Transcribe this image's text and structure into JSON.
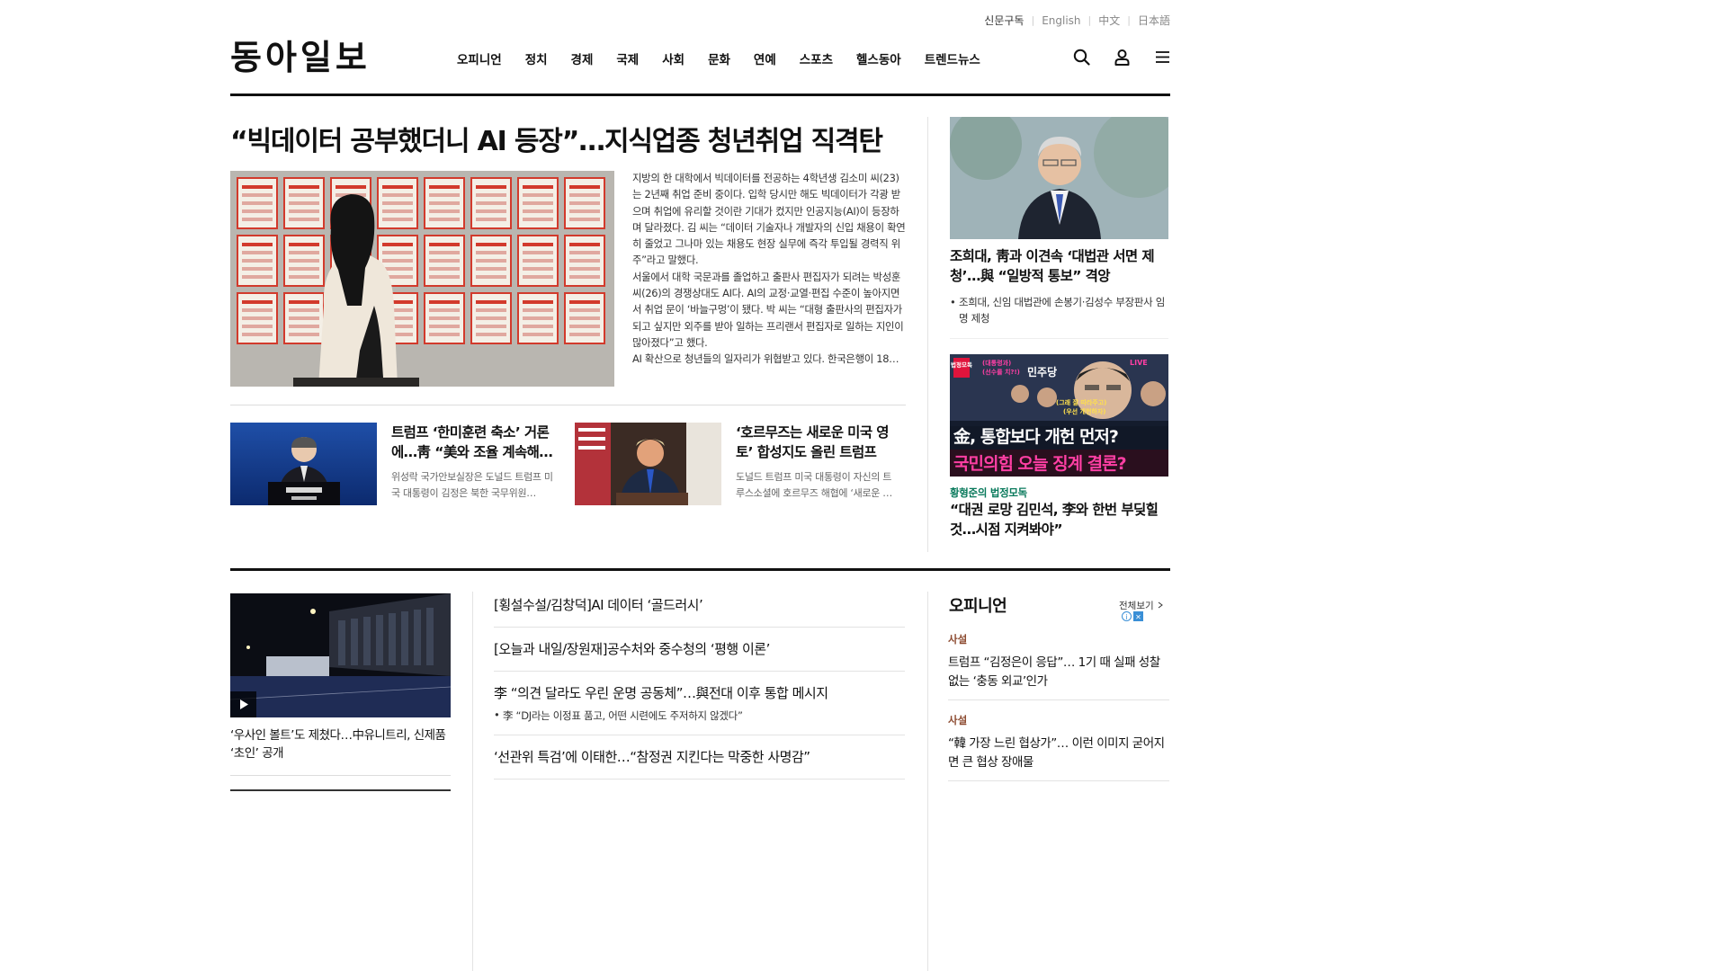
{
  "util_links": {
    "subscribe": "신문구독",
    "english": "English",
    "chinese": "中文",
    "japanese": "日本語"
  },
  "logo": "동아일보",
  "gnb": [
    "오피니언",
    "정치",
    "경제",
    "국제",
    "사회",
    "문화",
    "연예",
    "스포츠",
    "헬스동아",
    "트렌드뉴스"
  ],
  "icons": {
    "search": "search-icon",
    "user": "user-icon",
    "menu": "menu-icon",
    "play": "play-icon"
  },
  "top_story": {
    "title": "“빅데이터 공부했더니 AI 등장”…지식업종 청년취업 직격탄",
    "paragraphs": [
      "지방의 한 대학에서 빅데이터를 전공하는 4학년생 김소미 씨(23)는 2년째 취업 준비 중이다. 입학 당시만 해도 빅데이터가 각광 받으며 취업에 유리할 것이란 기대가 컸지만 인공지능(AI)이 등장하며 달라졌다. 김 씨는 “데이터 기술자나 개발자의 신입 채용이 확연히 줄었고 그나마 있는 채용도 현장 실무에 즉각 투입될 경력직 위주”라고 말했다.",
      "서울에서 대학 국문과를 졸업하고 출판사 편집자가 되려는 박성훈 씨(26)의 경쟁상대도 AI다. AI의 교정·교열·편집 수준이 높아지면서 취업 문이 ‘바늘구멍’이 됐다. 박 씨는 “대형 출판사의 편집자가 되고 싶지만 외주를 받아 일하는 프리랜서 편집자로 일하는 지인이 많아졌다”고 했다.",
      "AI 확산으로 청년들의 일자리가 위협받고 있다. 한국은행이 18…"
    ]
  },
  "sub_stories": [
    {
      "title": "트럼프 ‘한미훈련 축소’ 거론에…靑 “美와 조율 계속해 …",
      "desc": "위성락 국가안보실장은 도널드 트럼프 미국 대통령이 김정은 북한 국무위원…"
    },
    {
      "title": "‘호르무즈는 새로운 미국 영토’ 합성지도 올린 트럼프",
      "desc": "도널드 트럼프 미국 대통령이 자신의 트루스소셜에 호르무즈 해협에 ‘새로운 …"
    }
  ],
  "right_col": {
    "story1": {
      "title": "조희대, 靑과 이견속 ‘대법관 서면 제청’…與 “일방적 통보” 격앙",
      "bullet": "조희대, 신임 대법관에 손봉기·김성수 부장판사 임명 제청"
    },
    "promo": {
      "badge": "법정모독",
      "live": "LIVE",
      "tag1": "(대통령과)",
      "tag2": "(선수를 치?!)",
      "tag3": "민주당",
      "tag4": "(그래 잘 따라주고)",
      "tag5": "(우선 개헌하자)",
      "line1": "金, 통합보다 개헌 먼저?",
      "line2": "국민의힘 오늘 징계 결론?"
    },
    "story2": {
      "kicker": "황형준의 법정모독",
      "title": "“대권 로망 김민석, 李와 한번 부딪힐 것…시점 지켜봐야”"
    }
  },
  "video_story": {
    "title": "‘우사인 볼트’도 제쳤다…中유니트리, 신제품 ‘초인’ 공개"
  },
  "headline_list": [
    {
      "title": "[횡설수설/김창덕]AI 데이터 ‘골드러시’"
    },
    {
      "title": "[오늘과 내일/장원재]공수처와 중수청의 ‘평행 이론’"
    },
    {
      "title": "李 “의견 달라도 우린 운명 공동체”…與전대 이후 통합 메시지",
      "bullet": "李 “DJ라는 이정표 품고, 어떤 시련에도 주저하지 않겠다”"
    },
    {
      "title": "‘선관위 특검’에 이태한…“참정권 지킨다는 막중한 사명감”"
    }
  ],
  "opinion": {
    "heading": "오피니언",
    "view_all": "전체보기",
    "items": [
      {
        "kicker": "사설",
        "title": "트럼프 “김정은이 응답”… 1기 때 실패 성찰 없는 ‘충동 외교’인가"
      },
      {
        "kicker": "사설",
        "title": "“韓 가장 느린 협상가”… 이런 이미지 굳어지면 큰 협상 장애물"
      }
    ]
  },
  "colors": {
    "accent_green": "#0a7a5c",
    "opinion_kicker": "#8c4a2f",
    "promo_red": "#e0143c",
    "promo_magenta": "#ff3fa4"
  }
}
